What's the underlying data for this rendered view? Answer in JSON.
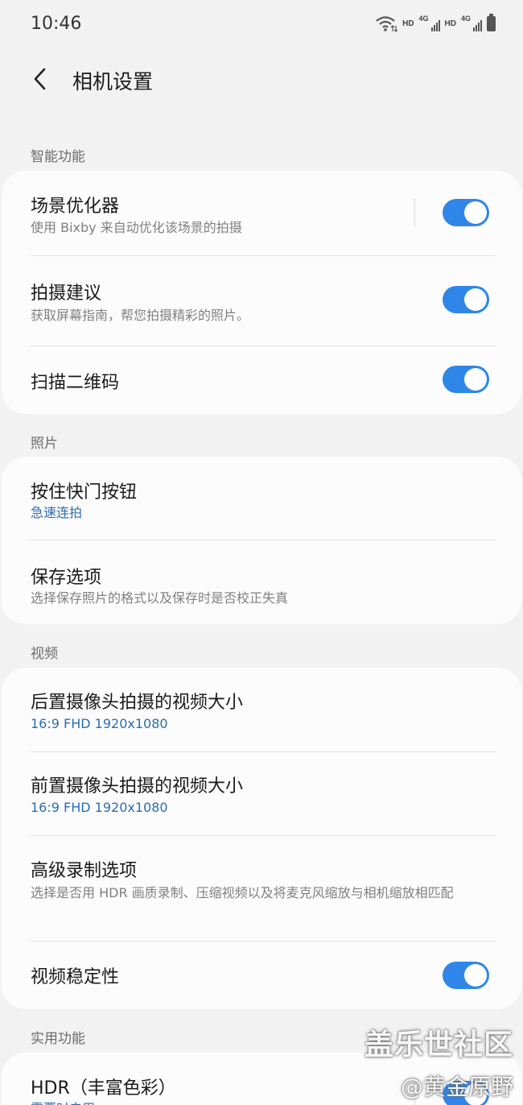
{
  "status_bar": {
    "time": "10:46",
    "hd1": "HD",
    "net1": "4G",
    "hd2": "HD",
    "net2": "4G"
  },
  "header": {
    "back_icon": "chevron-left-icon",
    "title": "相机设置"
  },
  "sections": {
    "smart": {
      "label": "智能功能",
      "items": {
        "scene": {
          "title": "场景优化器",
          "subtitle": "使用 Bixby 来自动优化该场景的拍摄",
          "toggle_on": true
        },
        "suggest": {
          "title": "拍摄建议",
          "subtitle": "获取屏幕指南，帮您拍摄精彩的照片。",
          "toggle_on": true
        },
        "qr": {
          "title": "扫描二维码",
          "toggle_on": true
        }
      }
    },
    "photo": {
      "label": "照片",
      "items": {
        "shutter": {
          "title": "按住快门按钮",
          "subtitle": "急速连拍"
        },
        "save": {
          "title": "保存选项",
          "subtitle": "选择保存照片的格式以及保存时是否校正失真"
        }
      }
    },
    "video": {
      "label": "视频",
      "items": {
        "rear": {
          "title": "后置摄像头拍摄的视频大小",
          "subtitle": "16:9 FHD 1920x1080"
        },
        "front": {
          "title": "前置摄像头拍摄的视频大小",
          "subtitle": "16:9 FHD 1920x1080"
        },
        "advanced": {
          "title": "高级录制选项",
          "subtitle": "选择是否用 HDR 画质录制、压缩视频以及将麦克风缩放与相机缩放相匹配"
        },
        "stabilize": {
          "title": "视频稳定性",
          "toggle_on": true
        }
      }
    },
    "useful": {
      "label": "实用功能",
      "items": {
        "hdr": {
          "title": "HDR（丰富色彩）",
          "subtitle": "需要时启用",
          "toggle_on": true
        }
      }
    }
  },
  "watermark": {
    "line1": "盖乐世社区",
    "line2": "@黄金原野"
  },
  "colors": {
    "accent": "#2f86e8",
    "link_text": "#2a6db5",
    "background": "#f2f2f2",
    "card": "#fcfcfc"
  }
}
